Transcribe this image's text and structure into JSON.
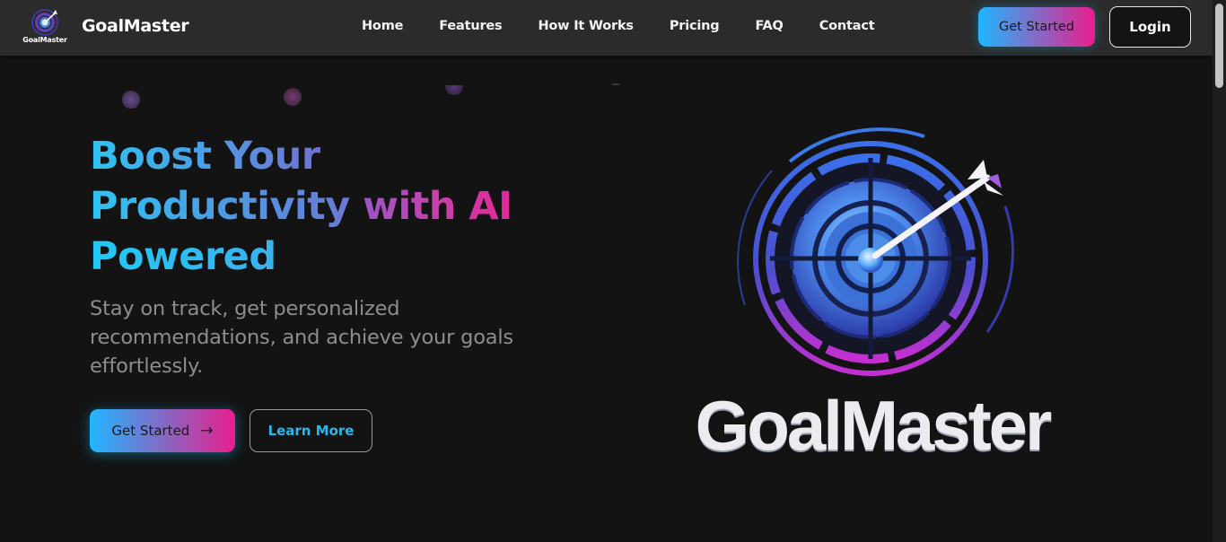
{
  "brand": {
    "logo_text": "GoalMaster",
    "name": "GoalMaster"
  },
  "nav": {
    "links": [
      "Home",
      "Features",
      "How It Works",
      "Pricing",
      "FAQ",
      "Contact"
    ],
    "get_started_label": "Get Started",
    "login_label": "Login"
  },
  "hero": {
    "title_line1": "Boost Your",
    "title_line2a": "Productivity",
    "title_line2b": "with AI",
    "title_line3": "Powered",
    "subtitle": "Stay on track, get personalized recommendations, and achieve your goals effortlessly.",
    "primary_button": "Get Started",
    "primary_button_icon": "arrow-right-icon",
    "secondary_button": "Learn More"
  },
  "showcase": {
    "logo_wordmark": "GoalMaster"
  },
  "colors": {
    "background": "#131313",
    "navbar": "#2b2b2b",
    "accent_start": "#1fb6ff",
    "accent_end": "#e91e8c",
    "subtitle_text": "#8d8d8d",
    "learn_more_text": "#29b7ec"
  }
}
